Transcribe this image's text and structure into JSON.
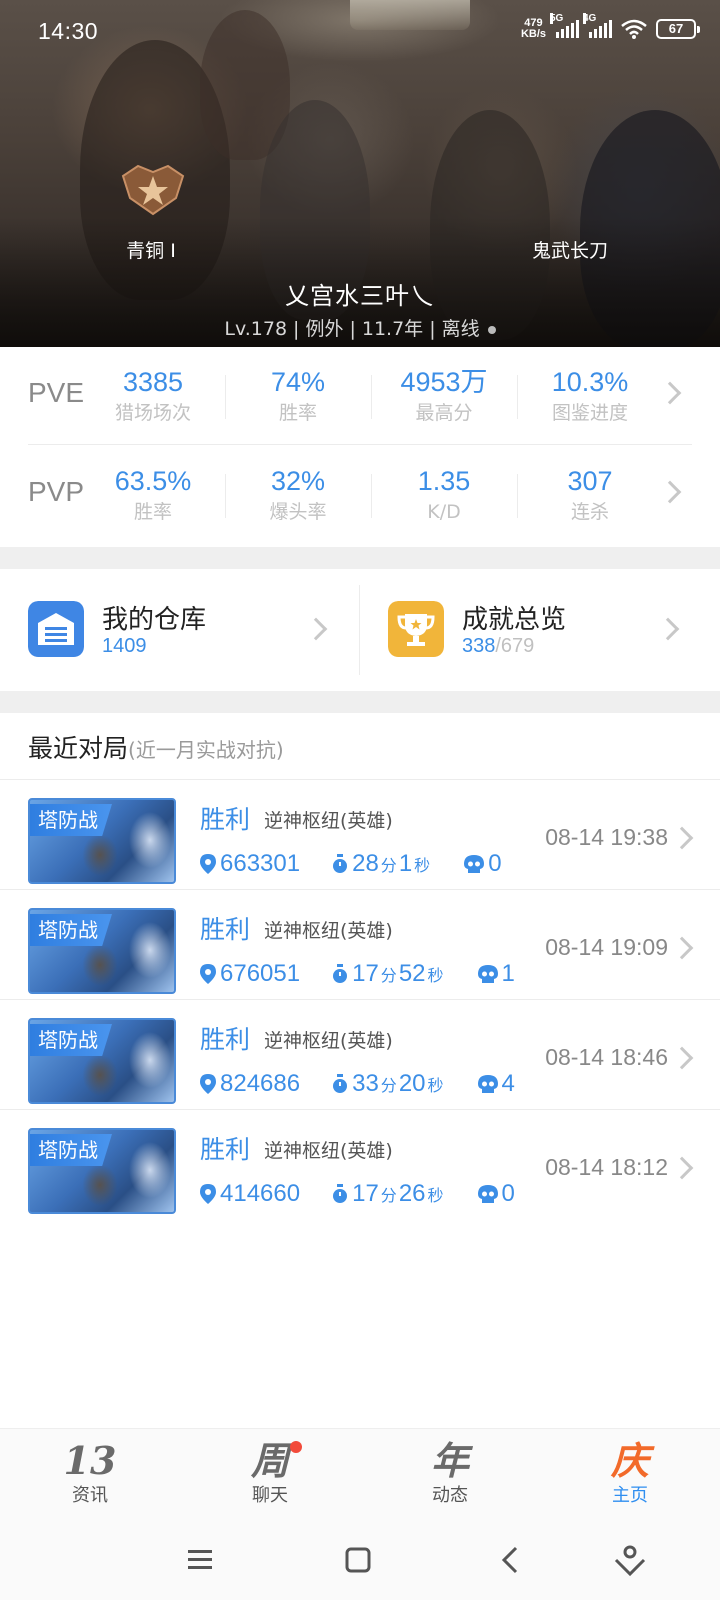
{
  "status_bar": {
    "time": "14:30",
    "net_speed_value": "479",
    "net_speed_unit": "KB/s",
    "signal1": "5G",
    "signal2": "4G",
    "battery": "67"
  },
  "profile": {
    "rank": "青铜 I",
    "weapon": "鬼武长刀",
    "name": "乂宫水三叶乀",
    "level": "Lv.178",
    "server": "例外",
    "years": "11.7年",
    "online_status": "离线"
  },
  "stats": {
    "pve": {
      "label": "PVE",
      "items": [
        {
          "value": "3385",
          "label": "猎场场次"
        },
        {
          "value": "74%",
          "label": "胜率"
        },
        {
          "value": "4953万",
          "label": "最高分"
        },
        {
          "value": "10.3%",
          "label": "图鉴进度"
        }
      ]
    },
    "pvp": {
      "label": "PVP",
      "items": [
        {
          "value": "63.5%",
          "label": "胜率"
        },
        {
          "value": "32%",
          "label": "爆头率"
        },
        {
          "value": "1.35",
          "label": "K/D"
        },
        {
          "value": "307",
          "label": "连杀"
        }
      ]
    }
  },
  "quick_links": {
    "warehouse": {
      "title": "我的仓库",
      "count": "1409",
      "icon": "warehouse-icon",
      "color": "#3f86e4"
    },
    "achievements": {
      "title": "成就总览",
      "done": "338",
      "total": "/679",
      "icon": "trophy-icon",
      "color": "#f1b53a"
    }
  },
  "recent": {
    "title": "最近对局",
    "subtitle": "(近一月实战对抗)",
    "matches": [
      {
        "mode": "塔防战",
        "result": "胜利",
        "map": "逆神枢纽(英雄)",
        "time": "08-14 19:38",
        "score": "663301",
        "dur_min": "28",
        "dur_min_unit": "分",
        "dur_sec": "1",
        "dur_sec_unit": "秒",
        "deaths": "0"
      },
      {
        "mode": "塔防战",
        "result": "胜利",
        "map": "逆神枢纽(英雄)",
        "time": "08-14 19:09",
        "score": "676051",
        "dur_min": "17",
        "dur_min_unit": "分",
        "dur_sec": "52",
        "dur_sec_unit": "秒",
        "deaths": "1"
      },
      {
        "mode": "塔防战",
        "result": "胜利",
        "map": "逆神枢纽(英雄)",
        "time": "08-14 18:46",
        "score": "824686",
        "dur_min": "33",
        "dur_min_unit": "分",
        "dur_sec": "20",
        "dur_sec_unit": "秒",
        "deaths": "4"
      },
      {
        "mode": "塔防战",
        "result": "胜利",
        "map": "逆神枢纽(英雄)",
        "time": "08-14 18:12",
        "score": "414660",
        "dur_min": "17",
        "dur_min_unit": "分",
        "dur_sec": "26",
        "dur_sec_unit": "秒",
        "deaths": "0"
      }
    ]
  },
  "bottom_nav": {
    "items": [
      {
        "glyph": "13",
        "label": "资讯"
      },
      {
        "glyph": "周",
        "label": "聊天",
        "badge": true
      },
      {
        "glyph": "年",
        "label": "动态"
      },
      {
        "glyph": "庆",
        "label": "主页",
        "active": true
      }
    ]
  },
  "colors": {
    "accent": "#3c8ee6",
    "active_nav": "#2f8ef0",
    "brand_orange": "#f26a2a"
  }
}
